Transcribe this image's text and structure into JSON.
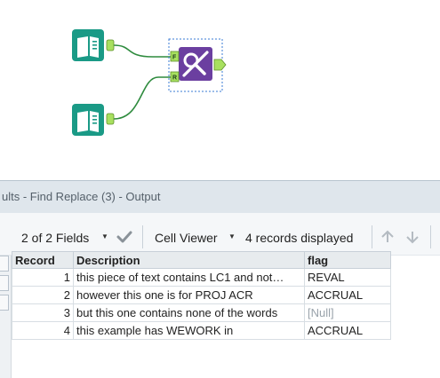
{
  "workflow": {
    "input_tool_1": {
      "icon": "input-book-icon"
    },
    "input_tool_2": {
      "icon": "input-book-icon"
    },
    "find_replace_tool": {
      "icon": "find-replace-icon",
      "anchor_f": "F",
      "anchor_r": "R"
    }
  },
  "results": {
    "title": "ults - Find Replace (3) - Output",
    "toolbar": {
      "fields_label": "2 of 2 Fields",
      "cell_viewer_label": "Cell Viewer",
      "records_label": "4 records displayed"
    },
    "columns": [
      "Record",
      "Description",
      "flag"
    ],
    "rows": [
      {
        "record": "1",
        "description": "this piece of text contains LC1 and not…",
        "flag": "REVAL",
        "null": false
      },
      {
        "record": "2",
        "description": "however this one is for PROJ ACR",
        "flag": "ACCRUAL",
        "null": false
      },
      {
        "record": "3",
        "description": "but this one contains none of the words",
        "flag": "[Null]",
        "null": true
      },
      {
        "record": "4",
        "description": "this example has WEWORK in",
        "flag": "ACCRUAL",
        "null": false
      }
    ]
  },
  "colors": {
    "input_tool": "#1a9a86",
    "find_replace_tool": "#6b3fa0",
    "connector": "#2e8b3e",
    "anchor": "#a8e05f"
  }
}
